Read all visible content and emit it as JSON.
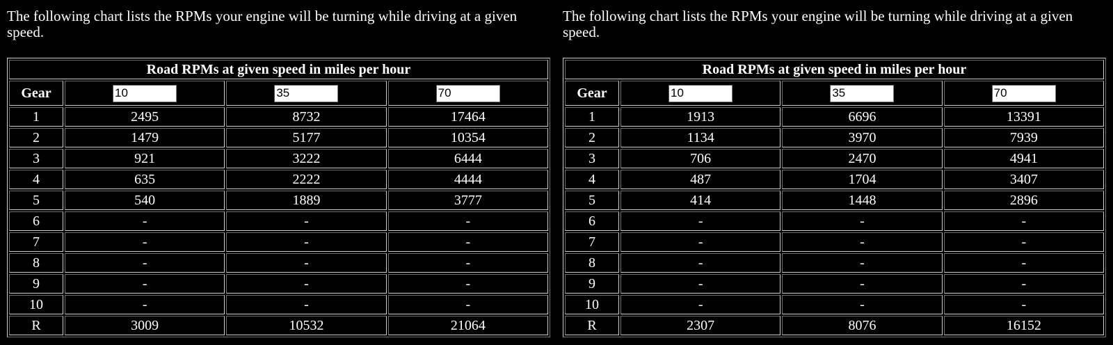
{
  "panels": [
    {
      "intro": "The following chart lists the RPMs your engine will be turning while driving at a given speed.",
      "table_title": "Road RPMs at given speed in miles per hour",
      "gear_header": "Gear",
      "speeds": [
        "10",
        "35",
        "70"
      ],
      "rows": [
        {
          "gear": "1",
          "values": [
            "2495",
            "8732",
            "17464"
          ]
        },
        {
          "gear": "2",
          "values": [
            "1479",
            "5177",
            "10354"
          ]
        },
        {
          "gear": "3",
          "values": [
            "921",
            "3222",
            "6444"
          ]
        },
        {
          "gear": "4",
          "values": [
            "635",
            "2222",
            "4444"
          ]
        },
        {
          "gear": "5",
          "values": [
            "540",
            "1889",
            "3777"
          ]
        },
        {
          "gear": "6",
          "values": [
            "-",
            "-",
            "-"
          ]
        },
        {
          "gear": "7",
          "values": [
            "-",
            "-",
            "-"
          ]
        },
        {
          "gear": "8",
          "values": [
            "-",
            "-",
            "-"
          ]
        },
        {
          "gear": "9",
          "values": [
            "-",
            "-",
            "-"
          ]
        },
        {
          "gear": "10",
          "values": [
            "-",
            "-",
            "-"
          ]
        },
        {
          "gear": "R",
          "values": [
            "3009",
            "10532",
            "21064"
          ]
        }
      ]
    },
    {
      "intro": "The following chart lists the RPMs your engine will be turning while driving at a given speed.",
      "table_title": "Road RPMs at given speed in miles per hour",
      "gear_header": "Gear",
      "speeds": [
        "10",
        "35",
        "70"
      ],
      "rows": [
        {
          "gear": "1",
          "values": [
            "1913",
            "6696",
            "13391"
          ]
        },
        {
          "gear": "2",
          "values": [
            "1134",
            "3970",
            "7939"
          ]
        },
        {
          "gear": "3",
          "values": [
            "706",
            "2470",
            "4941"
          ]
        },
        {
          "gear": "4",
          "values": [
            "487",
            "1704",
            "3407"
          ]
        },
        {
          "gear": "5",
          "values": [
            "414",
            "1448",
            "2896"
          ]
        },
        {
          "gear": "6",
          "values": [
            "-",
            "-",
            "-"
          ]
        },
        {
          "gear": "7",
          "values": [
            "-",
            "-",
            "-"
          ]
        },
        {
          "gear": "8",
          "values": [
            "-",
            "-",
            "-"
          ]
        },
        {
          "gear": "9",
          "values": [
            "-",
            "-",
            "-"
          ]
        },
        {
          "gear": "10",
          "values": [
            "-",
            "-",
            "-"
          ]
        },
        {
          "gear": "R",
          "values": [
            "2307",
            "8076",
            "16152"
          ]
        }
      ]
    }
  ]
}
